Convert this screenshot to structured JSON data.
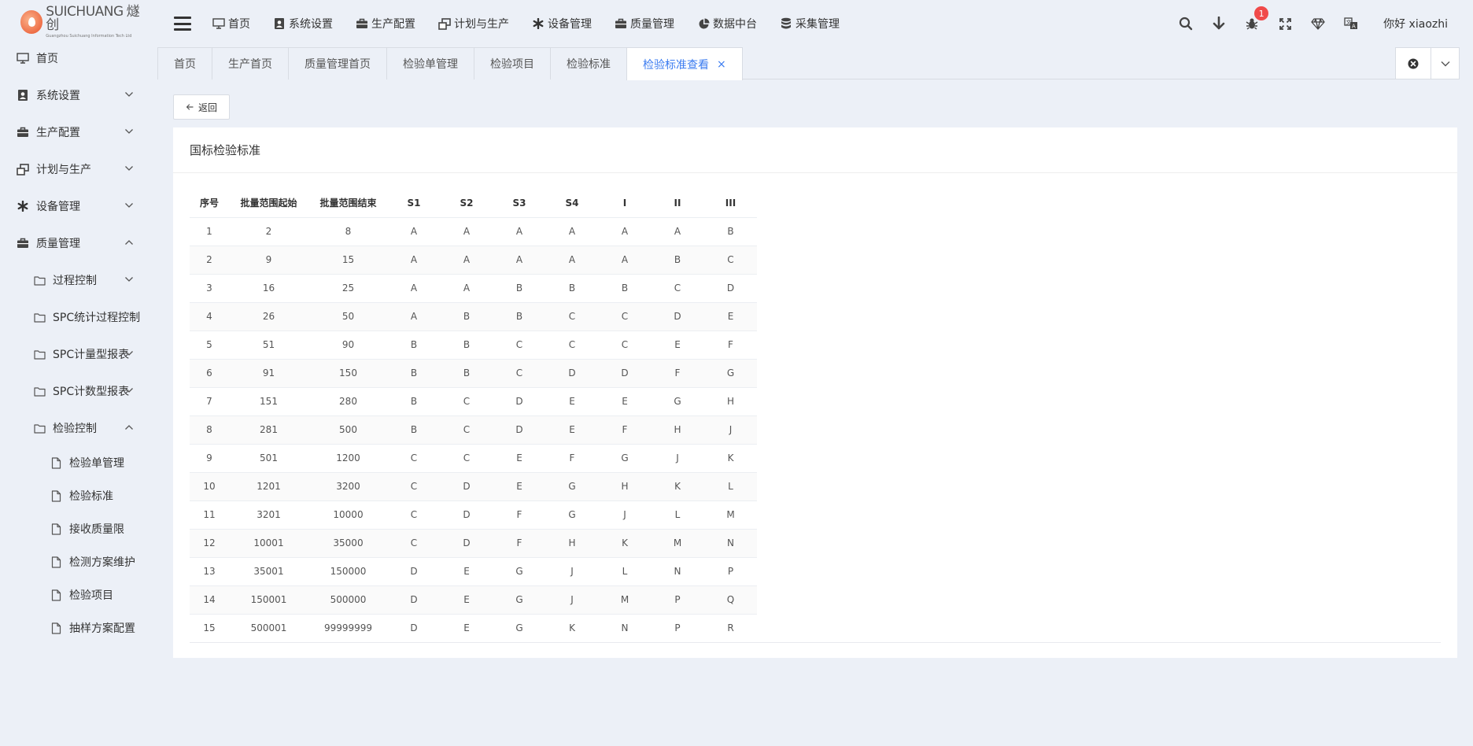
{
  "brand": {
    "name_en": "SUICHUANG",
    "name_cn": "燧创",
    "subtitle": "Guangzhou Suichuang Information Tech Ltd"
  },
  "sidebar": {
    "items": [
      {
        "label": "首页",
        "icon": "monitor-icon",
        "level": 1,
        "arrow": "none"
      },
      {
        "label": "系统设置",
        "icon": "user-badge-icon",
        "level": 1,
        "arrow": "down"
      },
      {
        "label": "生产配置",
        "icon": "briefcase-icon",
        "level": 1,
        "arrow": "down"
      },
      {
        "label": "计划与生产",
        "icon": "windows-icon",
        "level": 1,
        "arrow": "down"
      },
      {
        "label": "设备管理",
        "icon": "asterisk-icon",
        "level": 1,
        "arrow": "down"
      },
      {
        "label": "质量管理",
        "icon": "briefcase-icon",
        "level": 1,
        "arrow": "up"
      },
      {
        "label": "过程控制",
        "icon": "folder-icon",
        "level": 2,
        "arrow": "down"
      },
      {
        "label": "SPC统计过程控制",
        "icon": "folder-icon",
        "level": 2,
        "arrow": "none"
      },
      {
        "label": "SPC计量型报表",
        "icon": "folder-icon",
        "level": 2,
        "arrow": "down"
      },
      {
        "label": "SPC计数型报表",
        "icon": "folder-icon",
        "level": 2,
        "arrow": "down"
      },
      {
        "label": "检验控制",
        "icon": "folder-icon",
        "level": 2,
        "arrow": "up"
      },
      {
        "label": "检验单管理",
        "icon": "file-icon",
        "level": 3,
        "arrow": "none"
      },
      {
        "label": "检验标准",
        "icon": "file-icon",
        "level": 3,
        "arrow": "none"
      },
      {
        "label": "接收质量限",
        "icon": "file-icon",
        "level": 3,
        "arrow": "none"
      },
      {
        "label": "检测方案维护",
        "icon": "file-icon",
        "level": 3,
        "arrow": "none"
      },
      {
        "label": "检验项目",
        "icon": "file-icon",
        "level": 3,
        "arrow": "none"
      },
      {
        "label": "抽样方案配置",
        "icon": "file-icon",
        "level": 3,
        "arrow": "none"
      }
    ]
  },
  "topnav": {
    "menu": [
      {
        "label": "首页",
        "icon": "monitor-icon"
      },
      {
        "label": "系统设置",
        "icon": "user-badge-icon"
      },
      {
        "label": "生产配置",
        "icon": "briefcase-icon"
      },
      {
        "label": "计划与生产",
        "icon": "windows-icon"
      },
      {
        "label": "设备管理",
        "icon": "asterisk-icon"
      },
      {
        "label": "质量管理",
        "icon": "briefcase-icon"
      },
      {
        "label": "数据中台",
        "icon": "pie-chart-icon"
      },
      {
        "label": "采集管理",
        "icon": "database-icon"
      }
    ],
    "notification_count": "1",
    "greeting": "你好 xiaozhi"
  },
  "tabs": [
    {
      "label": "首页",
      "active": false
    },
    {
      "label": "生产首页",
      "active": false
    },
    {
      "label": "质量管理首页",
      "active": false
    },
    {
      "label": "检验单管理",
      "active": false
    },
    {
      "label": "检验项目",
      "active": false
    },
    {
      "label": "检验标准",
      "active": false
    },
    {
      "label": "检验标准查看",
      "active": true,
      "close": "×"
    }
  ],
  "back_label": "返回",
  "panel_title": "国标检验标准",
  "table": {
    "columns": [
      "序号",
      "批量范围起始",
      "批量范围结束",
      "S1",
      "S2",
      "S3",
      "S4",
      "I",
      "II",
      "III"
    ],
    "rows": [
      [
        "1",
        "2",
        "8",
        "A",
        "A",
        "A",
        "A",
        "A",
        "A",
        "B"
      ],
      [
        "2",
        "9",
        "15",
        "A",
        "A",
        "A",
        "A",
        "A",
        "B",
        "C"
      ],
      [
        "3",
        "16",
        "25",
        "A",
        "A",
        "B",
        "B",
        "B",
        "C",
        "D"
      ],
      [
        "4",
        "26",
        "50",
        "A",
        "B",
        "B",
        "C",
        "C",
        "D",
        "E"
      ],
      [
        "5",
        "51",
        "90",
        "B",
        "B",
        "C",
        "C",
        "C",
        "E",
        "F"
      ],
      [
        "6",
        "91",
        "150",
        "B",
        "B",
        "C",
        "D",
        "D",
        "F",
        "G"
      ],
      [
        "7",
        "151",
        "280",
        "B",
        "C",
        "D",
        "E",
        "E",
        "G",
        "H"
      ],
      [
        "8",
        "281",
        "500",
        "B",
        "C",
        "D",
        "E",
        "F",
        "H",
        "J"
      ],
      [
        "9",
        "501",
        "1200",
        "C",
        "C",
        "E",
        "F",
        "G",
        "J",
        "K"
      ],
      [
        "10",
        "1201",
        "3200",
        "C",
        "D",
        "E",
        "G",
        "H",
        "K",
        "L"
      ],
      [
        "11",
        "3201",
        "10000",
        "C",
        "D",
        "F",
        "G",
        "J",
        "L",
        "M"
      ],
      [
        "12",
        "10001",
        "35000",
        "C",
        "D",
        "F",
        "H",
        "K",
        "M",
        "N"
      ],
      [
        "13",
        "35001",
        "150000",
        "D",
        "E",
        "G",
        "J",
        "L",
        "N",
        "P"
      ],
      [
        "14",
        "150001",
        "500000",
        "D",
        "E",
        "G",
        "J",
        "M",
        "P",
        "Q"
      ],
      [
        "15",
        "500001",
        "99999999",
        "D",
        "E",
        "G",
        "K",
        "N",
        "P",
        "R"
      ]
    ]
  },
  "colors": {
    "accent": "#3a7bf0",
    "badge": "#f04a4a",
    "background": "#ecf0f7"
  }
}
